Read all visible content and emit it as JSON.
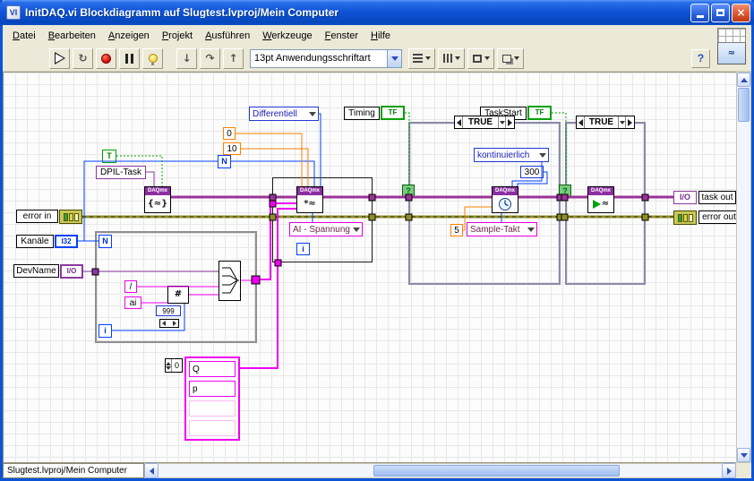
{
  "window": {
    "title": "InitDAQ.vi Blockdiagramm auf Slugtest.lvproj/Mein Computer"
  },
  "menu": {
    "items": [
      "Datei",
      "Bearbeiten",
      "Anzeigen",
      "Projekt",
      "Ausführen",
      "Werkzeuge",
      "Fenster",
      "Hilfe"
    ]
  },
  "toolbar": {
    "font_selector": "13pt Anwendungsschriftart"
  },
  "icons": {
    "app": "VI",
    "run_continuous": "↻",
    "step_into": "↓",
    "step_over": "↷",
    "step_out": "↑",
    "help": "?",
    "vi_thumb_glyph": "≈",
    "create_task_glyph": "{≈}",
    "channel_glyph": "*≈",
    "start_glyph": "≈",
    "fmt_glyph": "#"
  },
  "statusbar": {
    "path": "Slugtest.lvproj/Mein Computer"
  },
  "diagram": {
    "daqmx_label": "DAQmx",
    "enum_terminal_config": "Differentiell",
    "const_min": "0",
    "const_max": "10",
    "n_const": "N",
    "label_timing": "Timing",
    "tf_label": "TF",
    "label_taskstart": "TaskStart",
    "true_const": "T",
    "task_name": "DPIL-Task",
    "label_error_in": "error in",
    "label_kanaele": "Kanäle",
    "i32_label": "I32",
    "label_devname": "DevName",
    "io_label": "I/O",
    "loop_count": "N",
    "loop_index": "i",
    "const_slash": "/",
    "const_ai": "ai",
    "const_999": "999",
    "ring_channel_type": "AI - Spannung",
    "instance_label": "i",
    "case_selector": "TRUE",
    "selector_terminal": "?",
    "enum_sample_mode": "kontinuierlich",
    "const_samples": "300",
    "const_rate": "5",
    "ring_clock_source": "Sample-Takt",
    "label_task_out": "task out",
    "label_error_out": "error out",
    "array_index": "0",
    "array_items": [
      "Q",
      "p"
    ]
  },
  "colors": {
    "titlebar": "#0a55d8",
    "panel": "#ece9d8",
    "task_wire": "#993399",
    "error_wire": "#8f8f2a",
    "numeric_wire": "#ff8000",
    "int_wire": "#0040ff",
    "bool_wire": "#00a000",
    "string_wire": "#f000f0"
  }
}
